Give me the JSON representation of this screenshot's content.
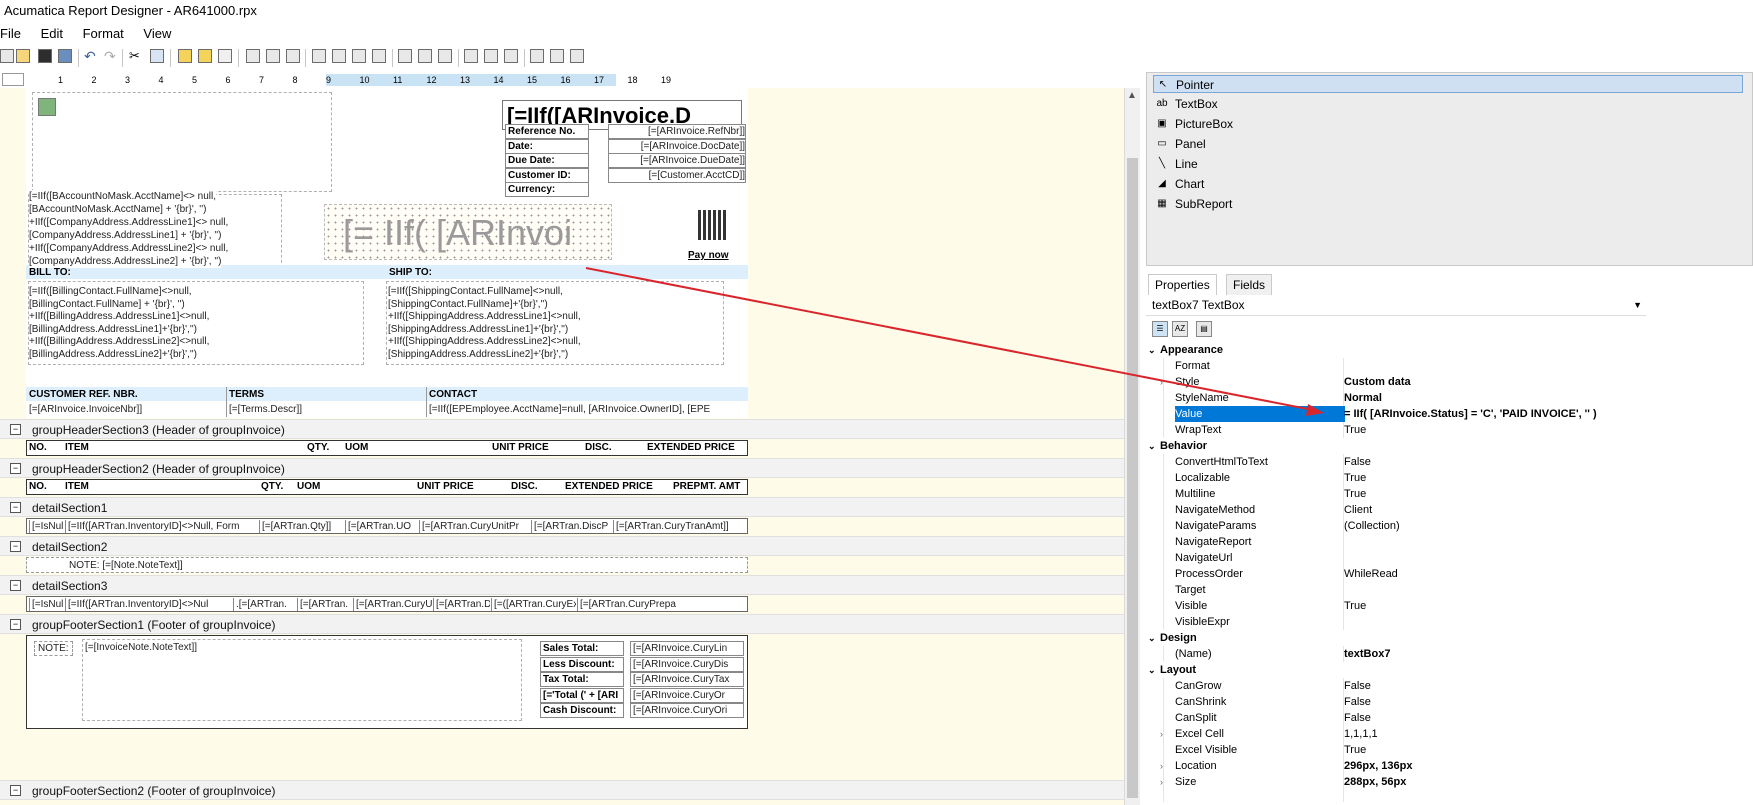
{
  "window": {
    "title": "Acumatica Report Designer - AR641000.rpx"
  },
  "menu": [
    "File",
    "Edit",
    "Format",
    "View"
  ],
  "ruler": {
    "ticks": [
      "1",
      "2",
      "3",
      "4",
      "5",
      "6",
      "7",
      "8",
      "9",
      "10",
      "11",
      "12",
      "13",
      "14",
      "15",
      "16",
      "17",
      "18",
      "19"
    ]
  },
  "report": {
    "title_expr": "[=IIf([ARInvoice.D",
    "watermark_expr": "[= IIf(  [ARInvoi",
    "pay_now": "Pay now",
    "ref_labels": [
      "Reference No.",
      "Date:",
      "Due Date:",
      "Customer ID:",
      "Currency:"
    ],
    "ref_values": [
      "[=[ARInvoice.RefNbr]]",
      "[=[ARInvoice.DocDate]]",
      "[=[ARInvoice.DueDate]]",
      "[=[Customer.AcctCD]]",
      ""
    ],
    "company_lines": [
      "[=IIf([BAccountNoMask.AcctName]<> null,",
      "[BAccountNoMask.AcctName] + '{br}', '')",
      "+IIf([CompanyAddress.AddressLine1]<> null,",
      "[CompanyAddress.AddressLine1] + '{br}', '')",
      "+IIf([CompanyAddress.AddressLine2]<> null,",
      "[CompanyAddress.AddressLine2] + '{br}', '')"
    ],
    "bill_to_label": "BILL TO:",
    "ship_to_label": "SHIP TO:",
    "bill_to_lines": [
      "[=IIf([BillingContact.FullName]<>null,",
      "[BillingContact.FullName] + '{br}', '')",
      "+IIf([BillingAddress.AddressLine1]<>null,",
      "[BillingAddress.AddressLine1]+'{br}','')",
      "+IIf([BillingAddress.AddressLine2]<>null,",
      "[BillingAddress.AddressLine2]+'{br}','')"
    ],
    "ship_to_lines": [
      "[=IIf([ShippingContact.FullName]<>null,",
      "[ShippingContact.FullName]+'{br}','')",
      "+IIf([ShippingAddress.AddressLine1]<>null,",
      "[ShippingAddress.AddressLine1]+'{br}','')",
      "+IIf([ShippingAddress.AddressLine2]<>null,",
      "[ShippingAddress.AddressLine2]+'{br}','')"
    ],
    "ref_header": [
      "CUSTOMER REF. NBR.",
      "TERMS",
      "CONTACT"
    ],
    "ref_row": [
      "[=[ARInvoice.InvoiceNbr]]",
      "[=[Terms.Descr]]",
      "[=IIf([EPEmployee.AcctName]=null, [ARInvoice.OwnerID], [EPE"
    ],
    "sections": [
      "groupHeaderSection3 (Header of groupInvoice)",
      "groupHeaderSection2 (Header of groupInvoice)",
      "detailSection1",
      "detailSection2",
      "detailSection3",
      "groupFooterSection1 (Footer of groupInvoice)",
      "groupFooterSection2 (Footer of groupInvoice)"
    ],
    "header3_cols": [
      "NO.",
      "ITEM",
      "QTY.",
      "UOM",
      "UNIT PRICE",
      "DISC.",
      "EXTENDED PRICE"
    ],
    "header2_cols": [
      "NO.",
      "ITEM",
      "QTY.",
      "UOM",
      "UNIT PRICE",
      "DISC.",
      "EXTENDED PRICE",
      "PREPMT. AMT"
    ],
    "detail1_cells": [
      "[=IsNul",
      "[=IIf([ARTran.InventoryID]<>Null, Form",
      "[=[ARTran.Qty]]",
      "[=[ARTran.UO",
      "[=[ARTran.CuryUnitPr",
      "[=[ARTran.DiscP",
      "[=[ARTran.CuryTranAmt]]"
    ],
    "detail2_text": "NOTE: [=[Note.NoteText]]",
    "detail3_cells": [
      "[=IsNul",
      "[=IIf([ARTran.InventoryID]<>Nul",
      ".[=[ARTran.",
      "[=[ARTran.",
      "[=[ARTran.CuryU",
      "[=[ARTran.Di",
      "[=([ARTran.CuryExtPric",
      "[=[ARTran.CuryPrepa"
    ],
    "footer_note_label": "NOTE:",
    "footer_note_value": "[=[InvoiceNote.NoteText]]",
    "totals_labels": [
      "Sales Total:",
      "Less Discount:",
      "Tax Total:",
      "[='Total (' + [ARI",
      "Cash Discount:"
    ],
    "totals_values": [
      "[=[ARInvoice.CuryLin",
      "[=[ARInvoice.CuryDis",
      "[=[ARInvoice.CuryTax",
      "[=[ARInvoice.CuryOr",
      "[=[ARInvoice.CuryOri"
    ]
  },
  "toolbox": {
    "items": [
      {
        "icon": "pointer-icon",
        "label": "Pointer",
        "selected": true
      },
      {
        "icon": "textbox-icon",
        "label": "TextBox"
      },
      {
        "icon": "picturebox-icon",
        "label": "PictureBox"
      },
      {
        "icon": "panel-icon",
        "label": "Panel"
      },
      {
        "icon": "line-icon",
        "label": "Line"
      },
      {
        "icon": "chart-icon",
        "label": "Chart"
      },
      {
        "icon": "subreport-icon",
        "label": "SubReport"
      }
    ]
  },
  "properties": {
    "tabs": [
      "Properties",
      "Fields"
    ],
    "object": "textBox7 TextBox",
    "rows": [
      {
        "type": "cat",
        "name": "Appearance"
      },
      {
        "name": "Format",
        "value": ""
      },
      {
        "name": "Style",
        "value": "Custom data",
        "bold": true,
        "expand": true
      },
      {
        "name": "StyleName",
        "value": "Normal",
        "bold": true
      },
      {
        "name": "Value",
        "value": "= IIf( [ARInvoice.Status] = 'C', 'PAID INVOICE', '' )",
        "bold": true,
        "selected": true
      },
      {
        "name": "WrapText",
        "value": "True"
      },
      {
        "type": "cat",
        "name": "Behavior"
      },
      {
        "name": "ConvertHtmlToText",
        "value": "False"
      },
      {
        "name": "Localizable",
        "value": "True"
      },
      {
        "name": "Multiline",
        "value": "True"
      },
      {
        "name": "NavigateMethod",
        "value": "Client"
      },
      {
        "name": "NavigateParams",
        "value": "(Collection)"
      },
      {
        "name": "NavigateReport",
        "value": ""
      },
      {
        "name": "NavigateUrl",
        "value": ""
      },
      {
        "name": "ProcessOrder",
        "value": "WhileRead"
      },
      {
        "name": "Target",
        "value": ""
      },
      {
        "name": "Visible",
        "value": "True"
      },
      {
        "name": "VisibleExpr",
        "value": ""
      },
      {
        "type": "cat",
        "name": "Design"
      },
      {
        "name": "(Name)",
        "value": "textBox7",
        "bold": true
      },
      {
        "type": "cat",
        "name": "Layout"
      },
      {
        "name": "CanGrow",
        "value": "False"
      },
      {
        "name": "CanShrink",
        "value": "False"
      },
      {
        "name": "CanSplit",
        "value": "False"
      },
      {
        "name": "Excel Cell",
        "value": "1,1,1,1",
        "expand": true
      },
      {
        "name": "Excel Visible",
        "value": "True"
      },
      {
        "name": "Location",
        "value": "296px, 136px",
        "bold": true,
        "expand": true
      },
      {
        "name": "Size",
        "value": "288px, 56px",
        "bold": true,
        "expand": true
      }
    ]
  },
  "colors": {
    "accent": "#0078d7",
    "surface": "#fffbe9",
    "arrow": "#d9262c",
    "band": "#ddeefc"
  }
}
